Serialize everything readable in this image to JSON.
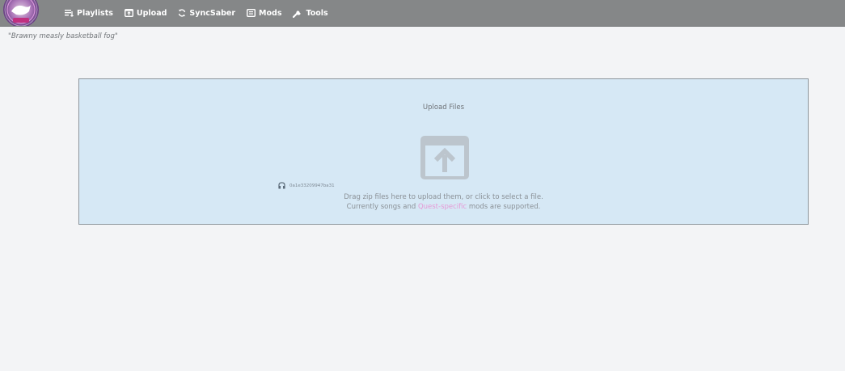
{
  "nav": {
    "items": [
      {
        "label": "Playlists",
        "icon": "playlists-icon"
      },
      {
        "label": "Upload",
        "icon": "upload-icon"
      },
      {
        "label": "SyncSaber",
        "icon": "sync-icon"
      },
      {
        "label": "Mods",
        "icon": "mods-icon"
      },
      {
        "label": "Tools",
        "icon": "wrench-icon"
      }
    ],
    "background": "#858788"
  },
  "tagline": "\"Brawny measly basketball fog\"",
  "upload": {
    "title": "Upload Files",
    "file_name": "0a1e33209947ba31",
    "instruction_line1": "Drag zip files here to upload them, or click to select a file.",
    "instruction_line2_prefix": "Currently songs and ",
    "instruction_line2_link": "Quest-specific",
    "instruction_line2_suffix": " mods are supported.",
    "colors": {
      "zone_background": "#d6e8f5",
      "quest_highlight": "#e69ad6"
    }
  }
}
